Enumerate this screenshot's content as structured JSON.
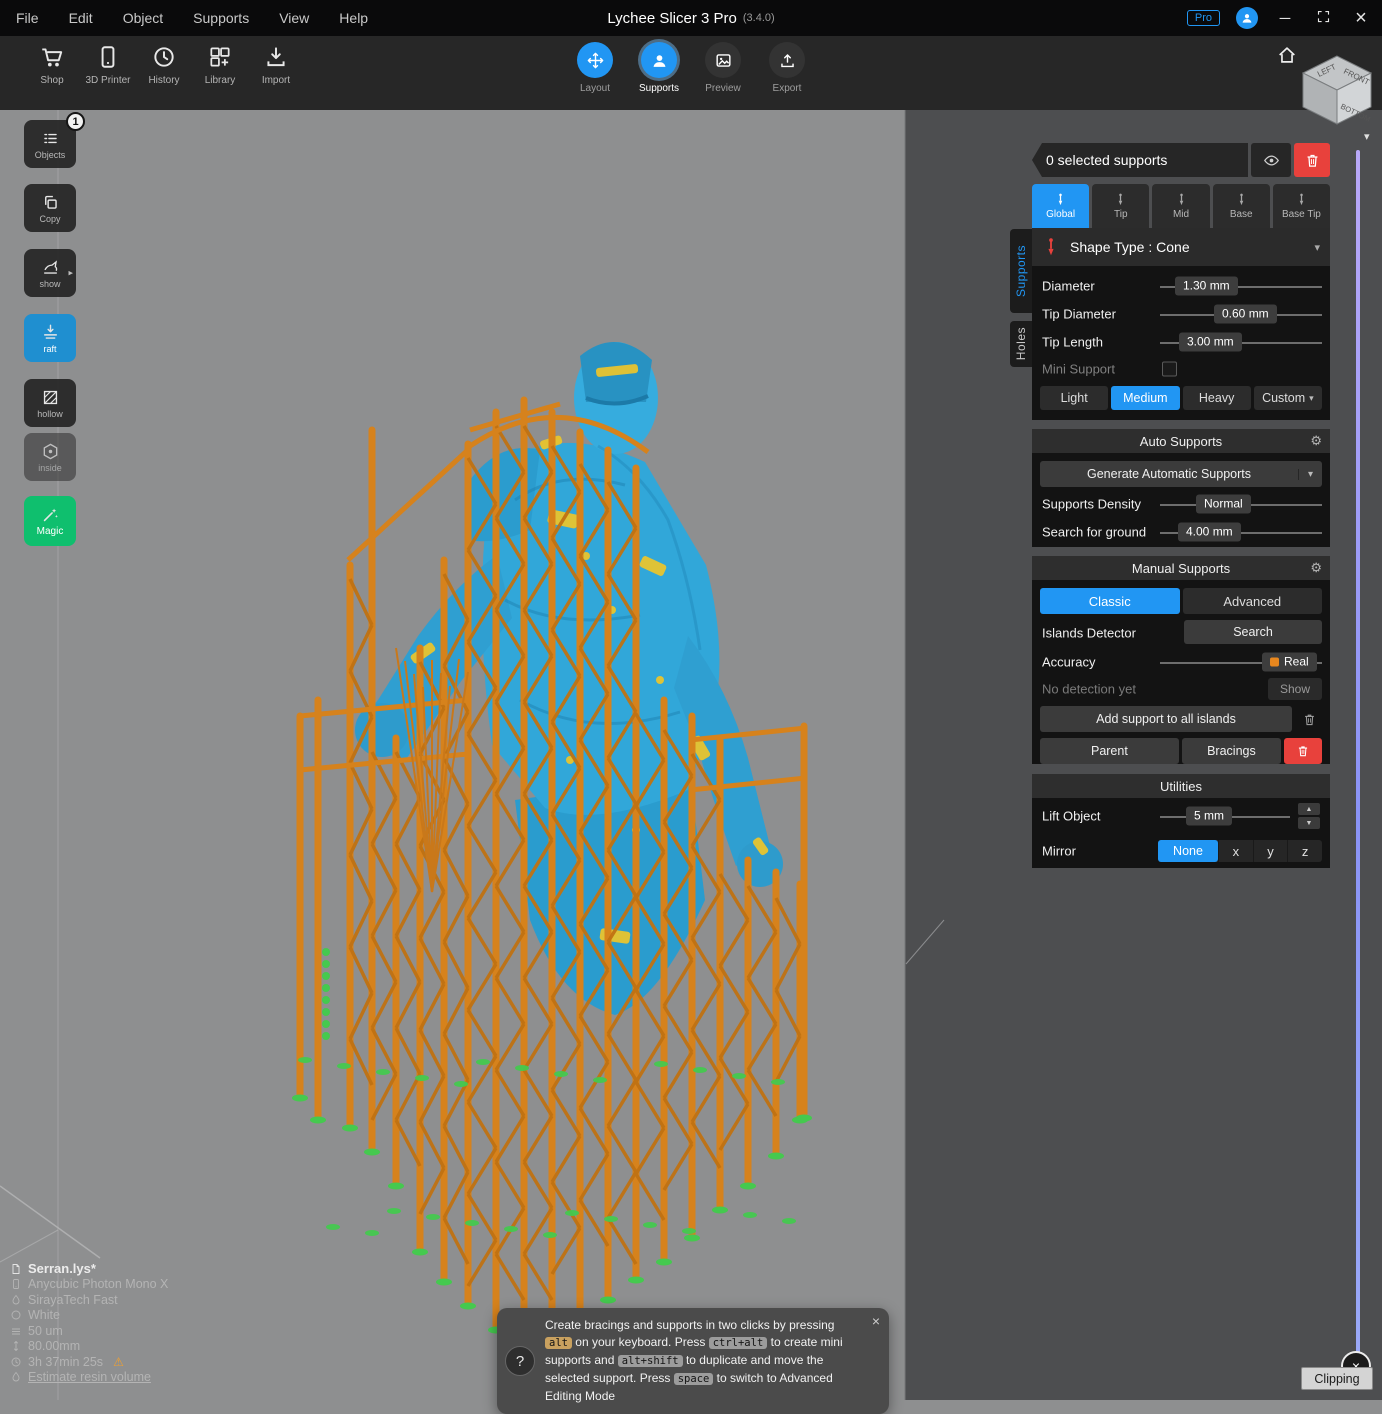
{
  "titlebar": {
    "menus": [
      "File",
      "Edit",
      "Object",
      "Supports",
      "View",
      "Help"
    ],
    "title": "Lychee Slicer 3 Pro",
    "version": "(3.4.0)",
    "pro_badge": "Pro"
  },
  "toolbar": {
    "items": [
      {
        "label": "Shop"
      },
      {
        "label": "3D Printer"
      },
      {
        "label": "History"
      },
      {
        "label": "Library"
      },
      {
        "label": "Import"
      }
    ],
    "modes": [
      {
        "label": "Layout"
      },
      {
        "label": "Supports"
      },
      {
        "label": "Preview"
      },
      {
        "label": "Export"
      }
    ],
    "cube": {
      "left": "LEFT",
      "front": "FRONT",
      "bottom": "BOTTOM"
    }
  },
  "sidebar": {
    "objects_badge": "1",
    "items": [
      {
        "label": "Objects"
      },
      {
        "label": "Copy"
      },
      {
        "label": "show"
      },
      {
        "label": "raft"
      },
      {
        "label": "hollow"
      },
      {
        "label": "inside"
      },
      {
        "label": "Magic"
      }
    ]
  },
  "panel": {
    "header": "0 selected supports",
    "tabs": [
      {
        "label": "Global"
      },
      {
        "label": "Tip"
      },
      {
        "label": "Mid"
      },
      {
        "label": "Base"
      },
      {
        "label": "Base Tip"
      }
    ],
    "side_tabs": {
      "supports": "Supports",
      "holes": "Holes"
    },
    "shape_type": "Shape Type : Cone",
    "diameter": {
      "label": "Diameter",
      "value": "1.30 mm"
    },
    "tip_diameter": {
      "label": "Tip Diameter",
      "value": "0.60 mm"
    },
    "tip_length": {
      "label": "Tip Length",
      "value": "3.00 mm"
    },
    "mini_support": "Mini Support",
    "density": [
      {
        "label": "Light"
      },
      {
        "label": "Medium"
      },
      {
        "label": "Heavy"
      },
      {
        "label": "Custom"
      }
    ],
    "auto": {
      "title": "Auto Supports",
      "generate": "Generate Automatic Supports",
      "density_label": "Supports Density",
      "density_value": "Normal",
      "ground_label": "Search for ground",
      "ground_value": "4.00 mm"
    },
    "manual": {
      "title": "Manual Supports",
      "classic": "Classic",
      "advanced": "Advanced",
      "islands_label": "Islands Detector",
      "search": "Search",
      "accuracy_label": "Accuracy",
      "accuracy_value": "Real",
      "no_detection": "No detection yet",
      "show": "Show",
      "add_all": "Add support to all islands",
      "parent": "Parent",
      "bracings": "Bracings"
    },
    "utilities": {
      "title": "Utilities",
      "lift_label": "Lift Object",
      "lift_value": "5 mm",
      "mirror_label": "Mirror",
      "mirror": [
        {
          "label": "None"
        },
        {
          "label": "x"
        },
        {
          "label": "y"
        },
        {
          "label": "z"
        }
      ]
    }
  },
  "status": {
    "file": "Serran.lys*",
    "printer": "Anycubic Photon Mono X",
    "resin": "SirayaTech Fast",
    "color": "White",
    "layer_height": "50 um",
    "z_height": "80.00mm",
    "print_time": "3h 37min 25s",
    "estimate_link": "Estimate resin volume"
  },
  "tooltip": {
    "help": "?",
    "s0": "Create bracings and supports in two clicks by pressing ",
    "k0": "alt",
    "s1": " on your keyboard. Press ",
    "k1": "ctrl+alt",
    "s2": " to create mini supports and ",
    "k2": "alt+shift",
    "s3": " to duplicate and move the selected support. Press ",
    "k3": "space",
    "s4": " to switch to Advanced Editing Mode"
  },
  "clipping": {
    "label": "Clipping"
  },
  "icons": {
    "gear": "⚙",
    "caret_down": "▾",
    "caret_right": "▸",
    "up": "▲",
    "down": "▼",
    "close": "×",
    "minimize": "─",
    "warning": "⚠",
    "clip_cross": "×"
  },
  "colors": {
    "accent": "#2196f3",
    "danger": "#e8413c",
    "magic_green": "#0fbf6e",
    "support_orange": "#d6821c",
    "pad_green": "#45c94f",
    "model_blue": "#31a7d9",
    "model_yellow": "#e8c52f"
  }
}
